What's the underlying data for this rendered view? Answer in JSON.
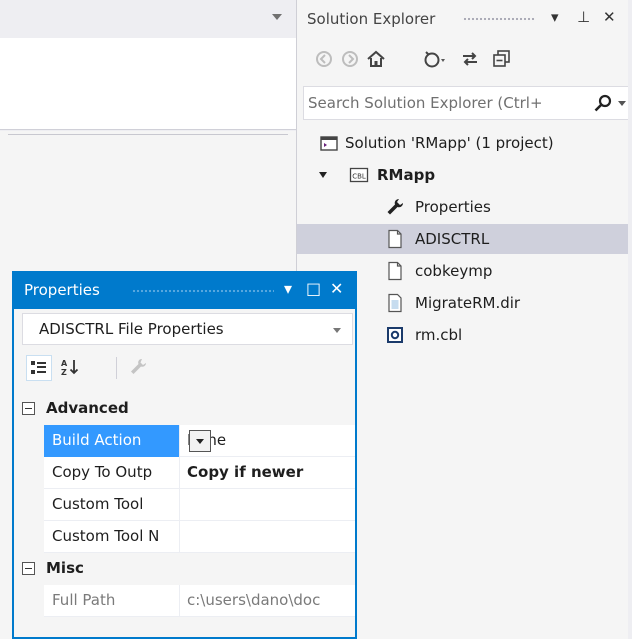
{
  "editor": {
    "dropdown_icon": "chevron-down-icon"
  },
  "solution_explorer": {
    "title": "Solution Explorer",
    "controls": {
      "dropdown": "▾",
      "pin": "⊥",
      "close": "✕"
    },
    "toolbar_icons": [
      "back-icon",
      "forward-icon",
      "home-icon",
      "history-icon",
      "sync-icon",
      "collapse-all-icon"
    ],
    "search_placeholder": "Search Solution Explorer (Ctrl+",
    "tree": [
      {
        "label": "Solution 'RMapp' (1 project)",
        "icon": "solution-icon"
      },
      {
        "label": "RMapp",
        "icon": "cobol-project-icon",
        "badge": "CBL",
        "bold": true
      },
      {
        "label": "Properties",
        "icon": "wrench-icon"
      },
      {
        "label": "ADISCTRL",
        "icon": "file-icon",
        "selected": true
      },
      {
        "label": "cobkeymp",
        "icon": "file-icon"
      },
      {
        "label": "MigrateRM.dir",
        "icon": "dir-file-icon"
      },
      {
        "label": "rm.cbl",
        "icon": "cbl-file-icon"
      }
    ]
  },
  "properties": {
    "title": "Properties",
    "controls": {
      "dropdown": "▾",
      "maximize": "□",
      "close": "✕"
    },
    "object_selector": "ADISCTRL File Properties",
    "toolbar_icons": [
      "categorized-icon",
      "alphabetical-icon",
      "property-pages-icon"
    ],
    "categories": [
      {
        "name": "Advanced",
        "rows": [
          {
            "name": "Build Action",
            "value": "None",
            "selected": true
          },
          {
            "name": "Copy To Outp",
            "value": "Copy if newer",
            "bold": true
          },
          {
            "name": "Custom Tool",
            "value": ""
          },
          {
            "name": "Custom Tool N",
            "value": ""
          }
        ]
      },
      {
        "name": "Misc",
        "rows": [
          {
            "name": "Full Path",
            "value": "c:\\users\\dano\\doc",
            "muted": true
          }
        ]
      }
    ]
  },
  "colors": {
    "accent": "#007acc",
    "selection": "#3399ff",
    "tree_selection": "#cfd0dc"
  }
}
